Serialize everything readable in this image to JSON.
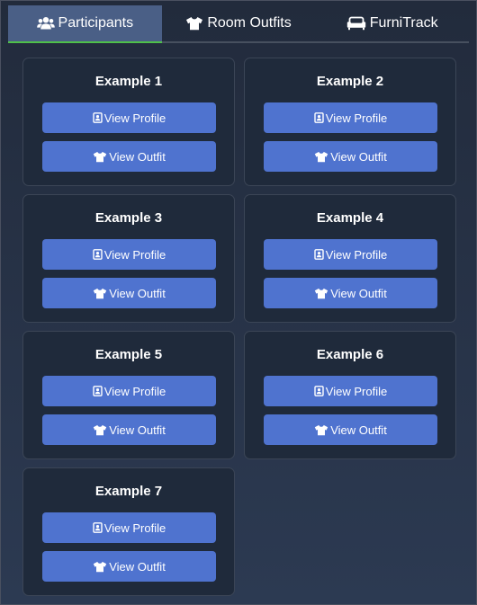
{
  "tabs": [
    {
      "label": "Participants",
      "icon": "users-icon",
      "active": true
    },
    {
      "label": "Room Outfits",
      "icon": "tshirt-icon",
      "active": false
    },
    {
      "label": "FurniTrack",
      "icon": "couch-icon",
      "active": false
    }
  ],
  "participants": [
    {
      "name": "Example 1",
      "profile_label": "View Profile",
      "outfit_label": "View Outfit"
    },
    {
      "name": "Example 2",
      "profile_label": "View Profile",
      "outfit_label": "View Outfit"
    },
    {
      "name": "Example 3",
      "profile_label": "View Profile",
      "outfit_label": "View Outfit"
    },
    {
      "name": "Example 4",
      "profile_label": "View Profile",
      "outfit_label": "View Outfit"
    },
    {
      "name": "Example 5",
      "profile_label": "View Profile",
      "outfit_label": "View Outfit"
    },
    {
      "name": "Example 6",
      "profile_label": "View Profile",
      "outfit_label": "View Outfit"
    },
    {
      "name": "Example 7",
      "profile_label": "View Profile",
      "outfit_label": "View Outfit"
    }
  ],
  "icons": {
    "profile": "id-badge-icon",
    "outfit": "tshirt-icon"
  },
  "colors": {
    "accent_button": "#4f73cf",
    "active_tab": "#4a5f86",
    "active_underline": "#4fc04a",
    "card_bg": "#1f2a3b"
  }
}
